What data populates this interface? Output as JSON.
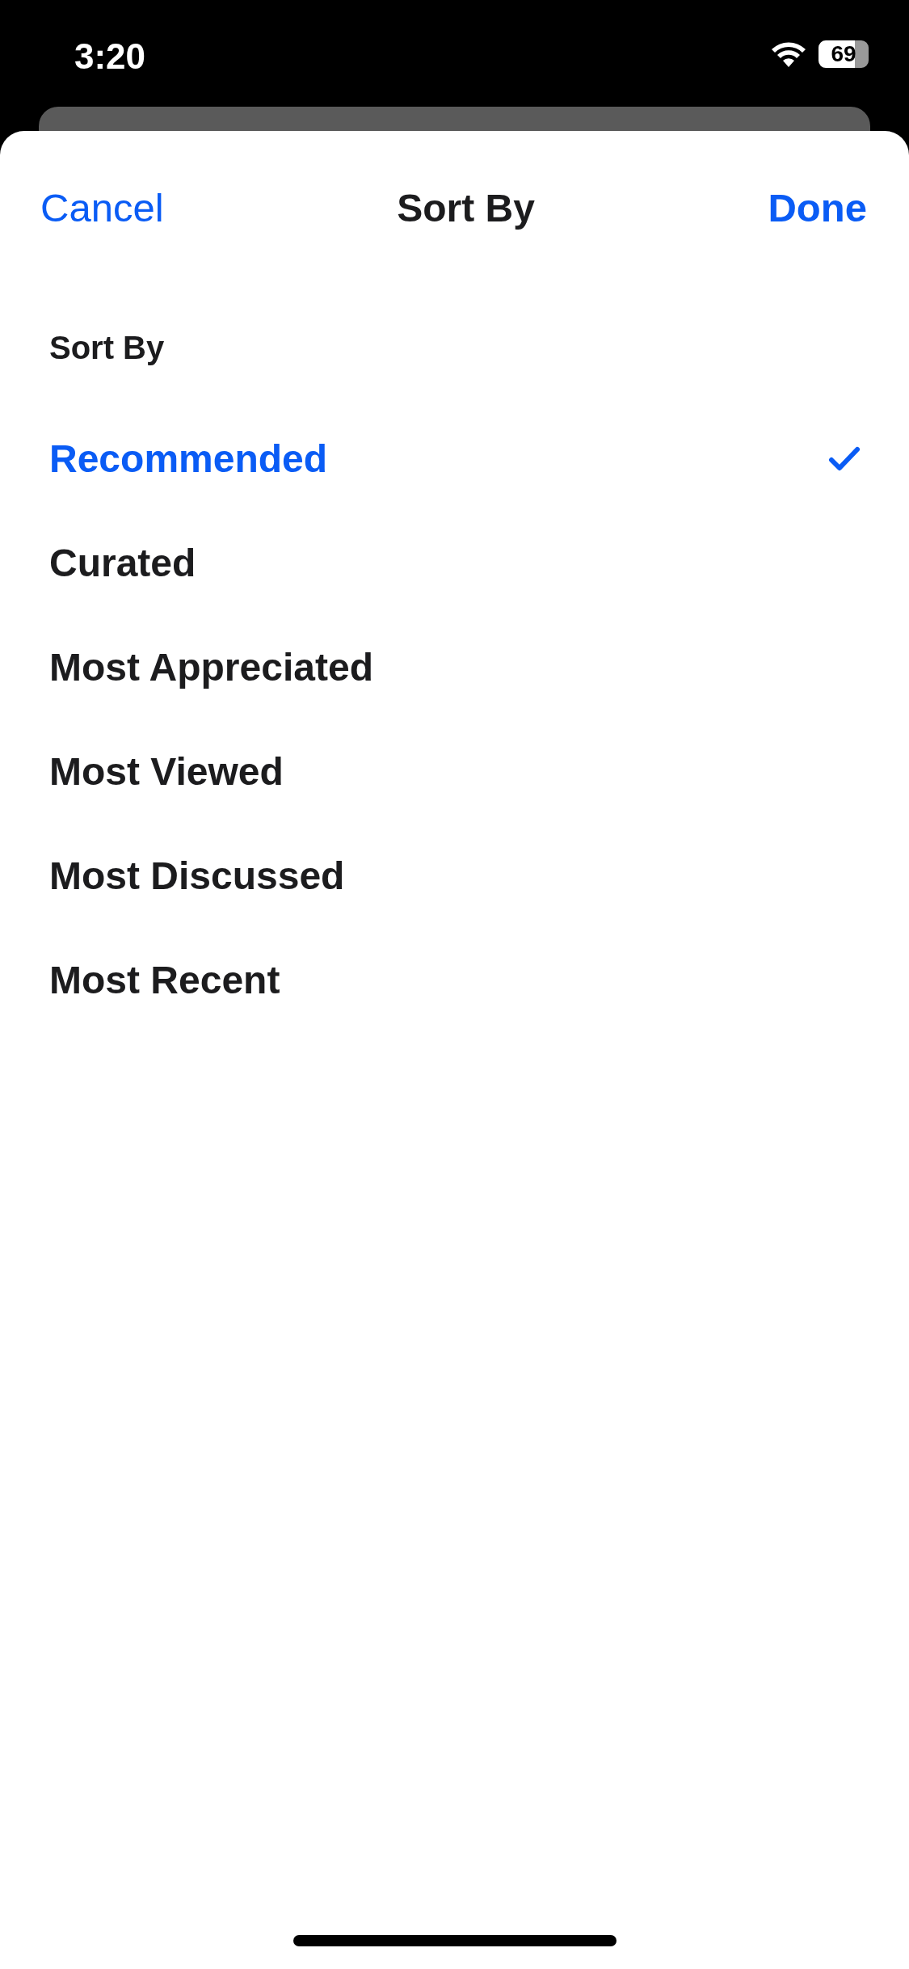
{
  "status_bar": {
    "time": "3:20",
    "battery": "69"
  },
  "nav": {
    "cancel": "Cancel",
    "title": "Sort By",
    "done": "Done"
  },
  "section": {
    "title": "Sort By",
    "options": [
      {
        "label": "Recommended",
        "selected": true
      },
      {
        "label": "Curated",
        "selected": false
      },
      {
        "label": "Most Appreciated",
        "selected": false
      },
      {
        "label": "Most Viewed",
        "selected": false
      },
      {
        "label": "Most Discussed",
        "selected": false
      },
      {
        "label": "Most Recent",
        "selected": false
      }
    ]
  }
}
